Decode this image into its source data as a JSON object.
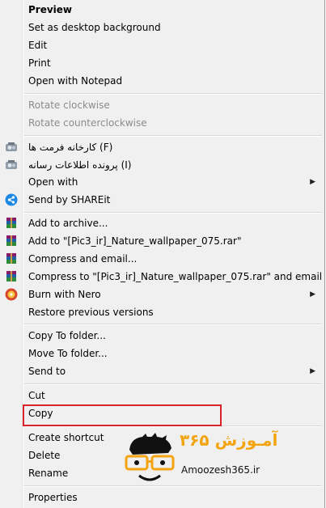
{
  "menu": {
    "items": [
      {
        "label": "Preview"
      },
      {
        "label": "Set as desktop background"
      },
      {
        "label": "Edit"
      },
      {
        "label": "Print"
      },
      {
        "label": "Open with Notepad"
      },
      {
        "label": "Rotate clockwise"
      },
      {
        "label": "Rotate counterclockwise"
      },
      {
        "label": "کارخانه فرمت ها (F)"
      },
      {
        "label": "پرونده اطلاعات رسانه (I)"
      },
      {
        "label": "Open with"
      },
      {
        "label": "Send by SHAREit"
      },
      {
        "label": "Add to archive..."
      },
      {
        "label": "Add to \"[Pic3_ir]_Nature_wallpaper_075.rar\""
      },
      {
        "label": "Compress and email..."
      },
      {
        "label": "Compress to \"[Pic3_ir]_Nature_wallpaper_075.rar\" and email"
      },
      {
        "label": "Burn with Nero"
      },
      {
        "label": "Restore previous versions"
      },
      {
        "label": "Copy To folder..."
      },
      {
        "label": "Move To folder..."
      },
      {
        "label": "Send to"
      },
      {
        "label": "Cut"
      },
      {
        "label": "Copy"
      },
      {
        "label": "Create shortcut"
      },
      {
        "label": "Delete"
      },
      {
        "label": "Rename"
      },
      {
        "label": "Properties"
      }
    ],
    "submenu_arrow": "▶"
  },
  "watermark": {
    "brand_text": "آمـوزش ۳۶۵",
    "site": "Amoozesh365.ir"
  },
  "colors": {
    "menu_bg": "#f0f0f0",
    "highlight_border": "#d8232a",
    "watermark_orange": "#f2a511"
  }
}
